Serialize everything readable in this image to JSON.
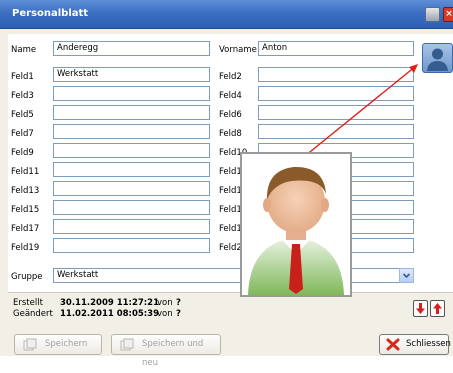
{
  "window": {
    "title": "Personalblatt"
  },
  "form": {
    "name_label": "Name",
    "name_value": "Anderegg",
    "vorname_label": "Vorname",
    "vorname_value": "Anton",
    "fields_left": [
      {
        "label": "Feld1",
        "value": "Werkstatt"
      },
      {
        "label": "Feld3",
        "value": ""
      },
      {
        "label": "Feld5",
        "value": ""
      },
      {
        "label": "Feld7",
        "value": ""
      },
      {
        "label": "Feld9",
        "value": ""
      },
      {
        "label": "Feld11",
        "value": ""
      },
      {
        "label": "Feld13",
        "value": ""
      },
      {
        "label": "Feld15",
        "value": ""
      },
      {
        "label": "Feld17",
        "value": ""
      },
      {
        "label": "Feld19",
        "value": ""
      }
    ],
    "fields_right": [
      {
        "label": "Feld2",
        "value": ""
      },
      {
        "label": "Feld4",
        "value": ""
      },
      {
        "label": "Feld6",
        "value": ""
      },
      {
        "label": "Feld8",
        "value": ""
      },
      {
        "label": "Feld10",
        "value": ""
      },
      {
        "label": "Feld1",
        "value": ""
      },
      {
        "label": "Feld1",
        "value": ""
      },
      {
        "label": "Feld1",
        "value": ""
      },
      {
        "label": "Feld1",
        "value": ""
      },
      {
        "label": "Feld2",
        "value": ""
      }
    ],
    "gruppe_label": "Gruppe",
    "gruppe_value": "Werkstatt"
  },
  "status": {
    "created_label": "Erstellt",
    "created_value": "30.11.2009 11:27:21",
    "created_by_label": "von",
    "created_by": "?",
    "changed_label": "Geändert",
    "changed_value": "11.02.2011 08:05:39",
    "changed_by_label": "von",
    "changed_by": "?"
  },
  "buttons": {
    "save": "Speichern",
    "save_new": "Speichern und neu",
    "close": "Schliessen"
  },
  "colors": {
    "titlebar": "#3c6fc2",
    "close_red": "#d23a2a",
    "pointer_line": "#e0201a"
  },
  "icons": {
    "photo": "person-icon",
    "close": "x-icon"
  }
}
